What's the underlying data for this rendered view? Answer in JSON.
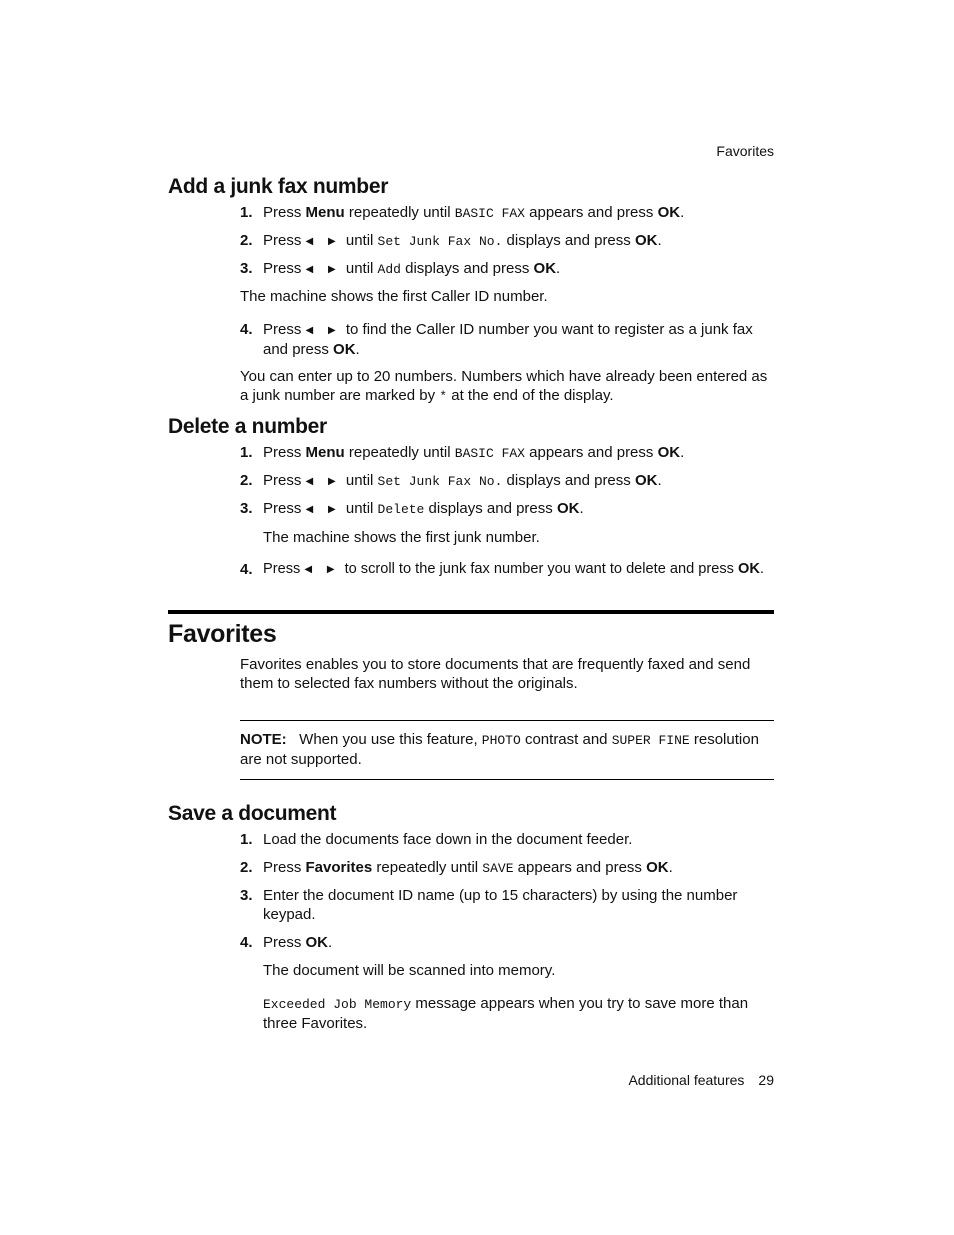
{
  "running_header": "Favorites",
  "sections": {
    "junk_add": {
      "title": "Add a junk fax number",
      "s1": {
        "n": "1.",
        "a": "Press ",
        "b": "Menu",
        "c": " repeatedly until ",
        "m": "BASIC FAX",
        "d": "  appears and press ",
        "e": "OK",
        "f": "."
      },
      "s2": {
        "n": "2.",
        "a": "Press ",
        "arrows": "◀ ▶",
        "c": " until ",
        "m": "Set Junk Fax No.",
        "d": "  displays and press ",
        "e": "OK",
        "f": "."
      },
      "s3": {
        "n": "3.",
        "a": "Press ",
        "arrows": "◀ ▶",
        "c": " until ",
        "m": "Add",
        "d": " displays and press ",
        "e": "OK",
        "f": "."
      },
      "p1": "The machine shows the first Caller ID number.",
      "s4": {
        "n": "4.",
        "a": "Press ",
        "arrows": "◀ ▶",
        "c": " to find the Caller ID number you want to register as a junk fax and press ",
        "e": "OK",
        "f": "."
      },
      "p2a": "You can enter up to 20 numbers. Numbers which have already been entered as a junk number are marked by ",
      "p2m": "*",
      "p2b": " at the end of the display."
    },
    "junk_delete": {
      "title": "Delete a number",
      "s1": {
        "n": "1.",
        "a": "Press ",
        "b": "Menu",
        "c": " repeatedly until ",
        "m": "BASIC FAX",
        "d": "  appears and press ",
        "e": "OK",
        "f": "."
      },
      "s2": {
        "n": "2.",
        "a": "Press ",
        "arrows": "◀ ▶",
        "c": " until ",
        "m": "Set Junk Fax No.",
        "d": "  displays and press ",
        "e": "OK",
        "f": "."
      },
      "s3": {
        "n": "3.",
        "a": "Press ",
        "arrows": "◀ ▶",
        "c": " until ",
        "m": "Delete",
        "d": " displays and press ",
        "e": "OK",
        "f": "."
      },
      "p1": "The machine shows the first junk number.",
      "s4": {
        "n": "4.",
        "a": "Press ",
        "arrows": "◀ ▶",
        "c": " to scroll to the junk fax number you want to delete and press ",
        "e": "OK",
        "f": "."
      }
    },
    "favorites": {
      "title": "Favorites",
      "intro": "Favorites enables you to store documents that are frequently faxed and send them to selected fax numbers without the originals.",
      "note_label": "NOTE:",
      "note_a": "   When you use this feature, ",
      "note_m1": "PHOTO",
      "note_b": " contrast and ",
      "note_m2": "SUPER FINE",
      "note_c": " resolution are not supported."
    },
    "save_doc": {
      "title": "Save a document",
      "s1": {
        "n": "1.",
        "t": "Load the documents face down in the document feeder."
      },
      "s2": {
        "n": "2.",
        "a": "Press ",
        "b": "Favorites",
        "c": " repeatedly until ",
        "m": "SAVE",
        "d": " appears and press ",
        "e": "OK",
        "f": "."
      },
      "s3": {
        "n": "3.",
        "t": "Enter the document ID name (up to 15 characters) by using the number keypad."
      },
      "s4": {
        "n": "4.",
        "a": "Press ",
        "e": "OK",
        "f": "."
      },
      "p1": "The document will be scanned into memory.",
      "p2m": "Exceeded Job Memory",
      "p2b": " message appears when you try to save more than three Favorites."
    }
  },
  "footer": {
    "label": "Additional features",
    "page": "29"
  }
}
